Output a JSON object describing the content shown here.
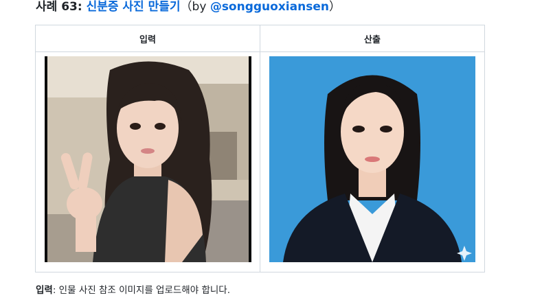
{
  "heading": {
    "prefix": "사례 63: ",
    "title_link": "신분증 사진 만들기",
    "paren_open": "（by ",
    "author_link": "@songguoxiansen",
    "paren_close": "）"
  },
  "table": {
    "headers": [
      "입력",
      "산출"
    ]
  },
  "note": {
    "label": "입력",
    "text": ": 인물 사진 참조 이미지를 업로드해야 합니다."
  },
  "colors": {
    "link": "#0969da",
    "border": "#d0d7de",
    "id_photo_background": "#3a9ad9"
  },
  "images": {
    "input": "selfie-photo",
    "output": "id-photo"
  }
}
